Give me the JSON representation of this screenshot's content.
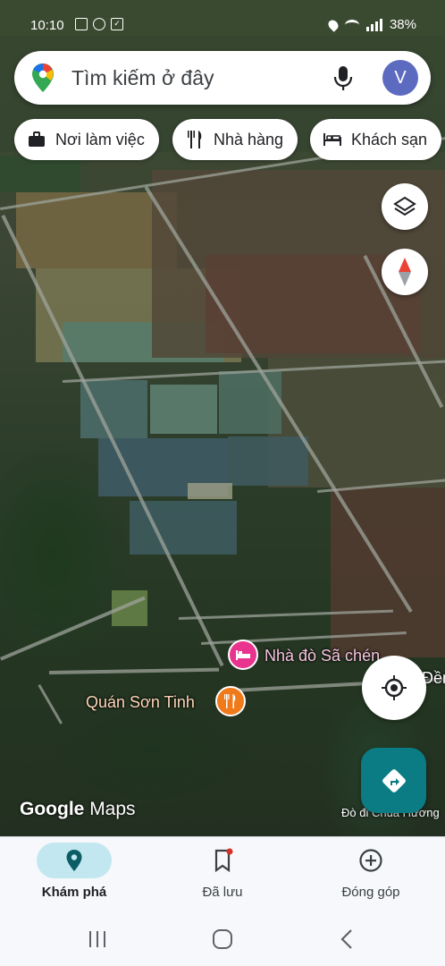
{
  "status_bar": {
    "time": "10:10",
    "battery": "38%"
  },
  "search": {
    "placeholder": "Tìm kiếm ở đây",
    "avatar_initial": "V"
  },
  "chips": [
    {
      "label": "Nơi làm việc",
      "icon": "briefcase-icon"
    },
    {
      "label": "Nhà hàng",
      "icon": "fork-knife-icon"
    },
    {
      "label": "Khách sạn",
      "icon": "bed-icon"
    }
  ],
  "map": {
    "places": [
      {
        "name": "Nhà đò Sã chén",
        "icon": "hotel-icon",
        "color": "#e8348f"
      },
      {
        "name": "Quán Sơn Tinh",
        "icon": "restaurant-icon",
        "color": "#f07a1a"
      },
      {
        "name": "Đền",
        "icon": "",
        "color": "#ffffff"
      }
    ],
    "ferry_route": "Đò đi Chùa Hương",
    "wordmark_bold": "Google",
    "wordmark_light": "Maps"
  },
  "bottom_nav": [
    {
      "label": "Khám phá",
      "icon": "explore-pin-icon",
      "active": true
    },
    {
      "label": "Đã lưu",
      "icon": "bookmark-icon",
      "active": false
    },
    {
      "label": "Đóng góp",
      "icon": "add-circle-icon",
      "active": false
    }
  ],
  "colors": {
    "accent": "#0b7c84",
    "active_pill": "#c2e7f0",
    "hotel": "#e8348f",
    "restaurant": "#f07a1a"
  }
}
